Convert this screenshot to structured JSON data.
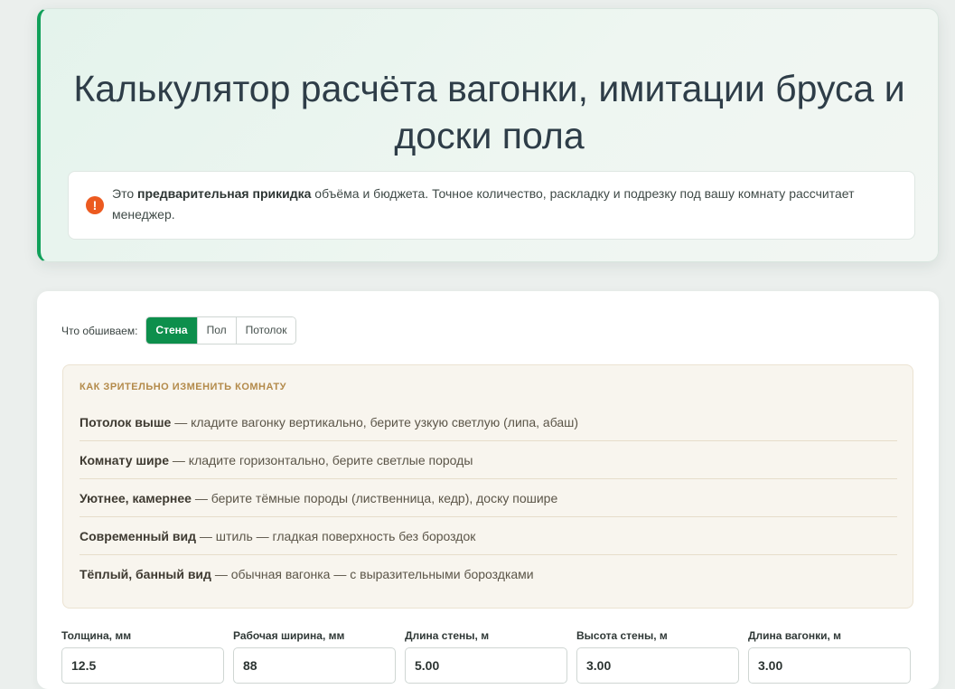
{
  "hero": {
    "title": "Калькулятор расчёта вагонки, имитации бруса и доски пола",
    "notice": {
      "icon": "exclamation-icon",
      "prefix": "Это ",
      "bold": "предварительная прикидка",
      "rest": " объёма и бюджета. Точное количество, раскладку и подрезку под вашу комнату рассчитает менеджер."
    }
  },
  "surface": {
    "label": "Что обшиваем:",
    "options": [
      "Стена",
      "Пол",
      "Потолок"
    ],
    "selected": "Стена"
  },
  "tips": {
    "title": "КАК ЗРИТЕЛЬНО ИЗМЕНИТЬ КОМНАТУ",
    "items": [
      {
        "bold": "Потолок выше",
        "text": " — кладите вагонку вертикально, берите узкую светлую (липа, абаш)"
      },
      {
        "bold": "Комнату шире",
        "text": " — кладите горизонтально, берите светлые породы"
      },
      {
        "bold": "Уютнее, камернее",
        "text": " — берите тёмные породы (лиственница, кедр), доску пошире"
      },
      {
        "bold": "Современный вид",
        "text": " — штиль — гладкая поверхность без бороздок"
      },
      {
        "bold": "Тёплый, банный вид",
        "text": " — обычная вагонка — с выразительными бороздками"
      }
    ]
  },
  "fields": [
    {
      "label": "Толщина, мм",
      "value": "12.5"
    },
    {
      "label": "Рабочая ширина, мм",
      "value": "88"
    },
    {
      "label": "Длина стены, м",
      "value": "5.00"
    },
    {
      "label": "Высота стены, м",
      "value": "3.00"
    },
    {
      "label": "Длина вагонки, м",
      "value": "3.00"
    }
  ],
  "colors": {
    "accent": "#11a05a",
    "active_segment": "#0d8f4c",
    "notice_icon": "#ec5a20",
    "tips_title": "#b38a4a"
  }
}
